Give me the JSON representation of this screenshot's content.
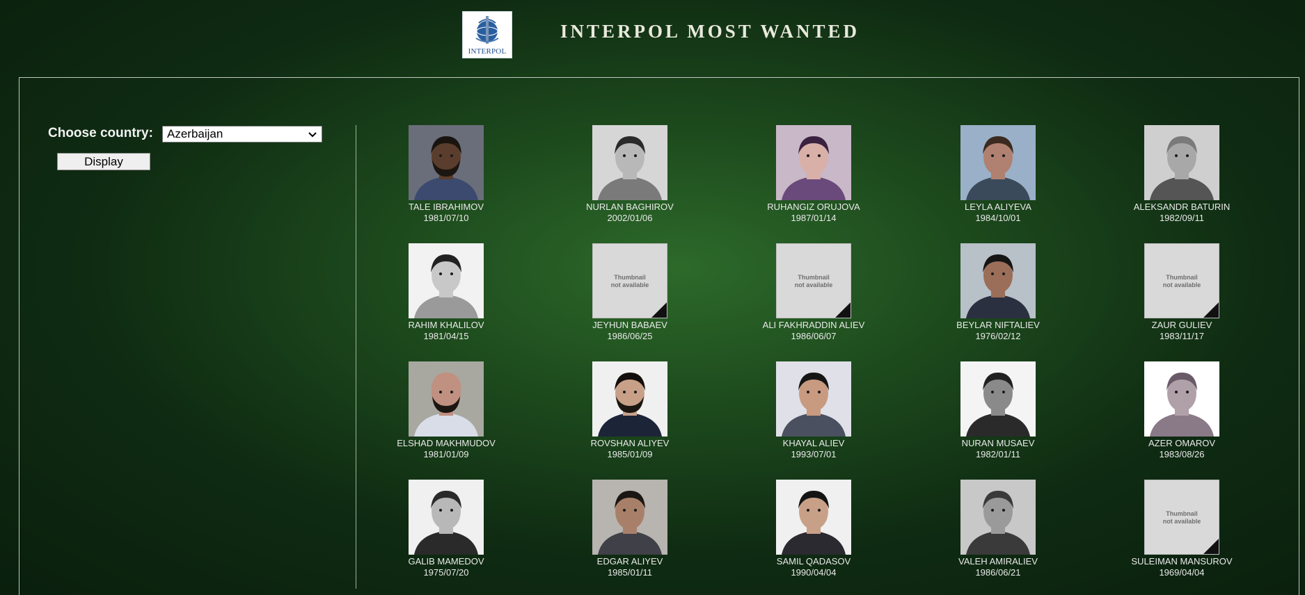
{
  "header": {
    "logo_text": "INTERPOL",
    "title": "INTERPOL MOST WANTED"
  },
  "filter": {
    "label": "Choose country:",
    "selected_country": "Azerbaijan",
    "display_button": "Display"
  },
  "thumbnail_placeholder": {
    "line1": "Thumbnail",
    "line2": "not available"
  },
  "people": [
    {
      "name": "TALE IBRAHIMOV",
      "dob": "1981/07/10",
      "photo": "available",
      "bg": "#6a6e7a",
      "skin": "#5a3d2c",
      "shirt": "#3b4a6e",
      "hair": "#1a1410",
      "beard": true
    },
    {
      "name": "NURLAN BAGHIROV",
      "dob": "2002/01/06",
      "photo": "available",
      "bg": "#d6d6d6",
      "skin": "#b8b8b8",
      "shirt": "#7a7a7a",
      "hair": "#2a2a2a",
      "beard": false
    },
    {
      "name": "RUHANGIZ ORUJOVA",
      "dob": "1987/01/14",
      "photo": "available",
      "bg": "#c8b8c8",
      "skin": "#d8b0a8",
      "shirt": "#6a4a7a",
      "hair": "#3a2240",
      "beard": false
    },
    {
      "name": "LEYLA ALIYEVA",
      "dob": "1984/10/01",
      "photo": "available",
      "bg": "#9ab0c8",
      "skin": "#b08070",
      "shirt": "#3a4a5a",
      "hair": "#3a2a20",
      "beard": false
    },
    {
      "name": "ALEKSANDR BATURIN",
      "dob": "1982/09/11",
      "photo": "available",
      "bg": "#cfcfcf",
      "skin": "#a8a8a8",
      "shirt": "#555555",
      "hair": "#7a7a7a",
      "beard": false
    },
    {
      "name": "RAHIM KHALILOV",
      "dob": "1981/04/15",
      "photo": "available",
      "bg": "#f2f2f2",
      "skin": "#c8c8c8",
      "shirt": "#9a9a9a",
      "hair": "#222222",
      "beard": false
    },
    {
      "name": "JEYHUN BABAEV",
      "dob": "1986/06/25",
      "photo": "not_available"
    },
    {
      "name": "ALI FAKHRADDIN ALIEV",
      "dob": "1986/06/07",
      "photo": "not_available"
    },
    {
      "name": "BEYLAR NIFTALIEV",
      "dob": "1976/02/12",
      "photo": "available",
      "bg": "#b8c0c8",
      "skin": "#9a6e58",
      "shirt": "#2a3040",
      "hair": "#151515",
      "beard": false
    },
    {
      "name": "ZAUR GULIEV",
      "dob": "1983/11/17",
      "photo": "not_available"
    },
    {
      "name": "ELSHAD MAKHMUDOV",
      "dob": "1981/01/09",
      "photo": "available",
      "bg": "#a8a8a0",
      "skin": "#c09080",
      "shirt": "#d8dde8",
      "hair": "#c09080",
      "beard": true
    },
    {
      "name": "ROVSHAN ALIYEV",
      "dob": "1985/01/09",
      "photo": "available",
      "bg": "#f0f0f0",
      "skin": "#c8a088",
      "shirt": "#1c2438",
      "hair": "#120e0c",
      "beard": true
    },
    {
      "name": "KHAYAL ALIEV",
      "dob": "1993/07/01",
      "photo": "available",
      "bg": "#e0e0e8",
      "skin": "#c89a80",
      "shirt": "#4a5060",
      "hair": "#151515",
      "beard": false
    },
    {
      "name": "NURAN MUSAEV",
      "dob": "1982/01/11",
      "photo": "available",
      "bg": "#f4f4f4",
      "skin": "#8a8a8a",
      "shirt": "#2a2a2a",
      "hair": "#202020",
      "beard": false
    },
    {
      "name": "AZER OMAROV",
      "dob": "1983/08/26",
      "photo": "available",
      "bg": "#ffffff",
      "skin": "#b0a0a8",
      "shirt": "#8a7a88",
      "hair": "#6a5a68",
      "beard": false
    },
    {
      "name": "GALIB MAMEDOV",
      "dob": "1975/07/20",
      "photo": "available",
      "bg": "#f0f0f0",
      "skin": "#b8b8b8",
      "shirt": "#2a2a2a",
      "hair": "#2a2a2a",
      "beard": false
    },
    {
      "name": "EDGAR ALIYEV",
      "dob": "1985/01/11",
      "photo": "available",
      "bg": "#b8b4b0",
      "skin": "#a8806a",
      "shirt": "#404048",
      "hair": "#1a1614",
      "beard": false
    },
    {
      "name": "SAMIL QADASOV",
      "dob": "1990/04/04",
      "photo": "available",
      "bg": "#f0f0f0",
      "skin": "#c8a088",
      "shirt": "#2a2a30",
      "hair": "#141414",
      "beard": false
    },
    {
      "name": "VALEH AMIRALIEV",
      "dob": "1986/06/21",
      "photo": "available",
      "bg": "#c8c8c8",
      "skin": "#9a9a9a",
      "shirt": "#3a3a3a",
      "hair": "#3a3a3a",
      "beard": false
    },
    {
      "name": "SULEIMAN MANSUROV",
      "dob": "1969/04/04",
      "photo": "not_available"
    }
  ]
}
